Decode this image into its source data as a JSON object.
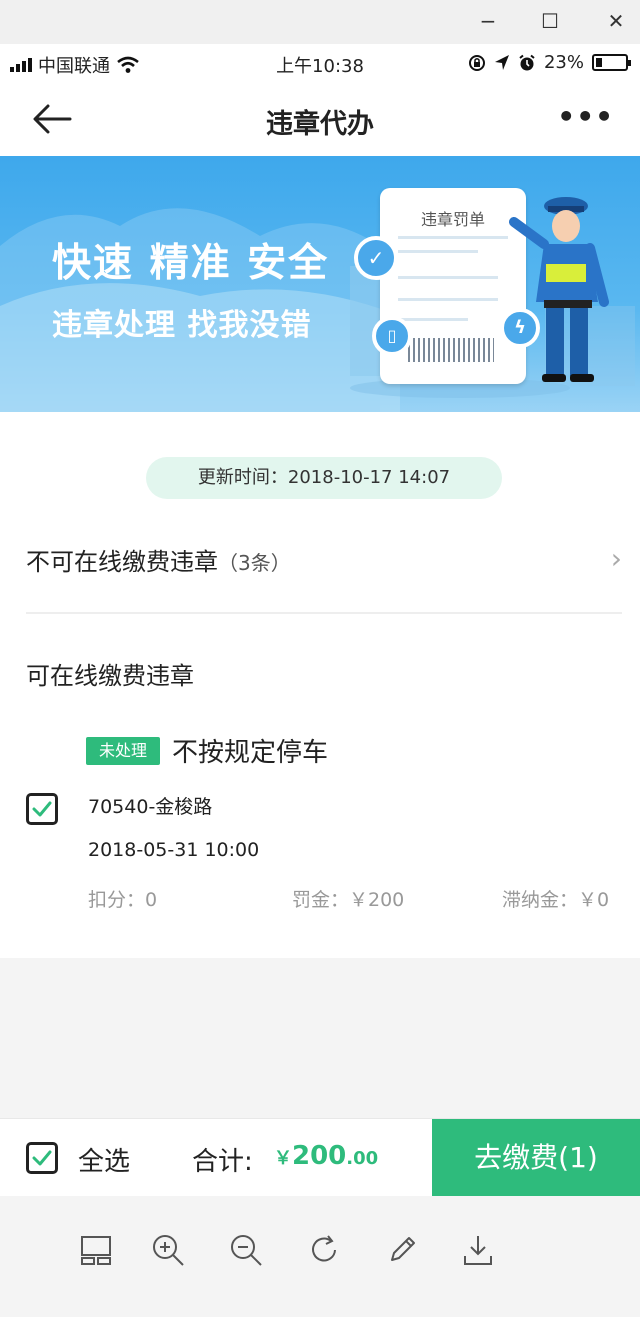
{
  "window": {
    "minimize": "−",
    "maximize": "☐",
    "close": "✕"
  },
  "status": {
    "carrier": "中国联通",
    "time": "上午10:38",
    "battery": "23%",
    "battery_fraction": 0.23
  },
  "nav": {
    "title": "违章代办",
    "more": "•••"
  },
  "banner": {
    "headline": "快速 精准 安全",
    "subline": "违章处理 找我没错",
    "ticket_title": "违章罚单"
  },
  "content": {
    "update_time": "更新时间：2018-10-17 14:07",
    "offline": {
      "label": "不可在线缴费违章",
      "count": "（3条）"
    },
    "online_title": "可在线缴费违章",
    "violation": {
      "tag": "未处理",
      "title": "不按规定停车",
      "address": "70540-金梭路",
      "time": "2018-05-31 10:00",
      "points": "扣分：0",
      "fine": "罚金：￥200",
      "late_fee": "滞纳金：￥0"
    }
  },
  "bottom": {
    "select_all": "全选",
    "total_label": "合计:",
    "total_yen": "￥",
    "total_int": "200",
    "total_dec": ".00",
    "pay_button": "去缴费(1)"
  },
  "toolbar": [
    "layout-icon",
    "zoom-in-icon",
    "zoom-out-icon",
    "rotate-icon",
    "edit-icon",
    "download-icon"
  ],
  "colors": {
    "green": "#2ebb7c",
    "banner_blue": "#3ea8ec"
  }
}
